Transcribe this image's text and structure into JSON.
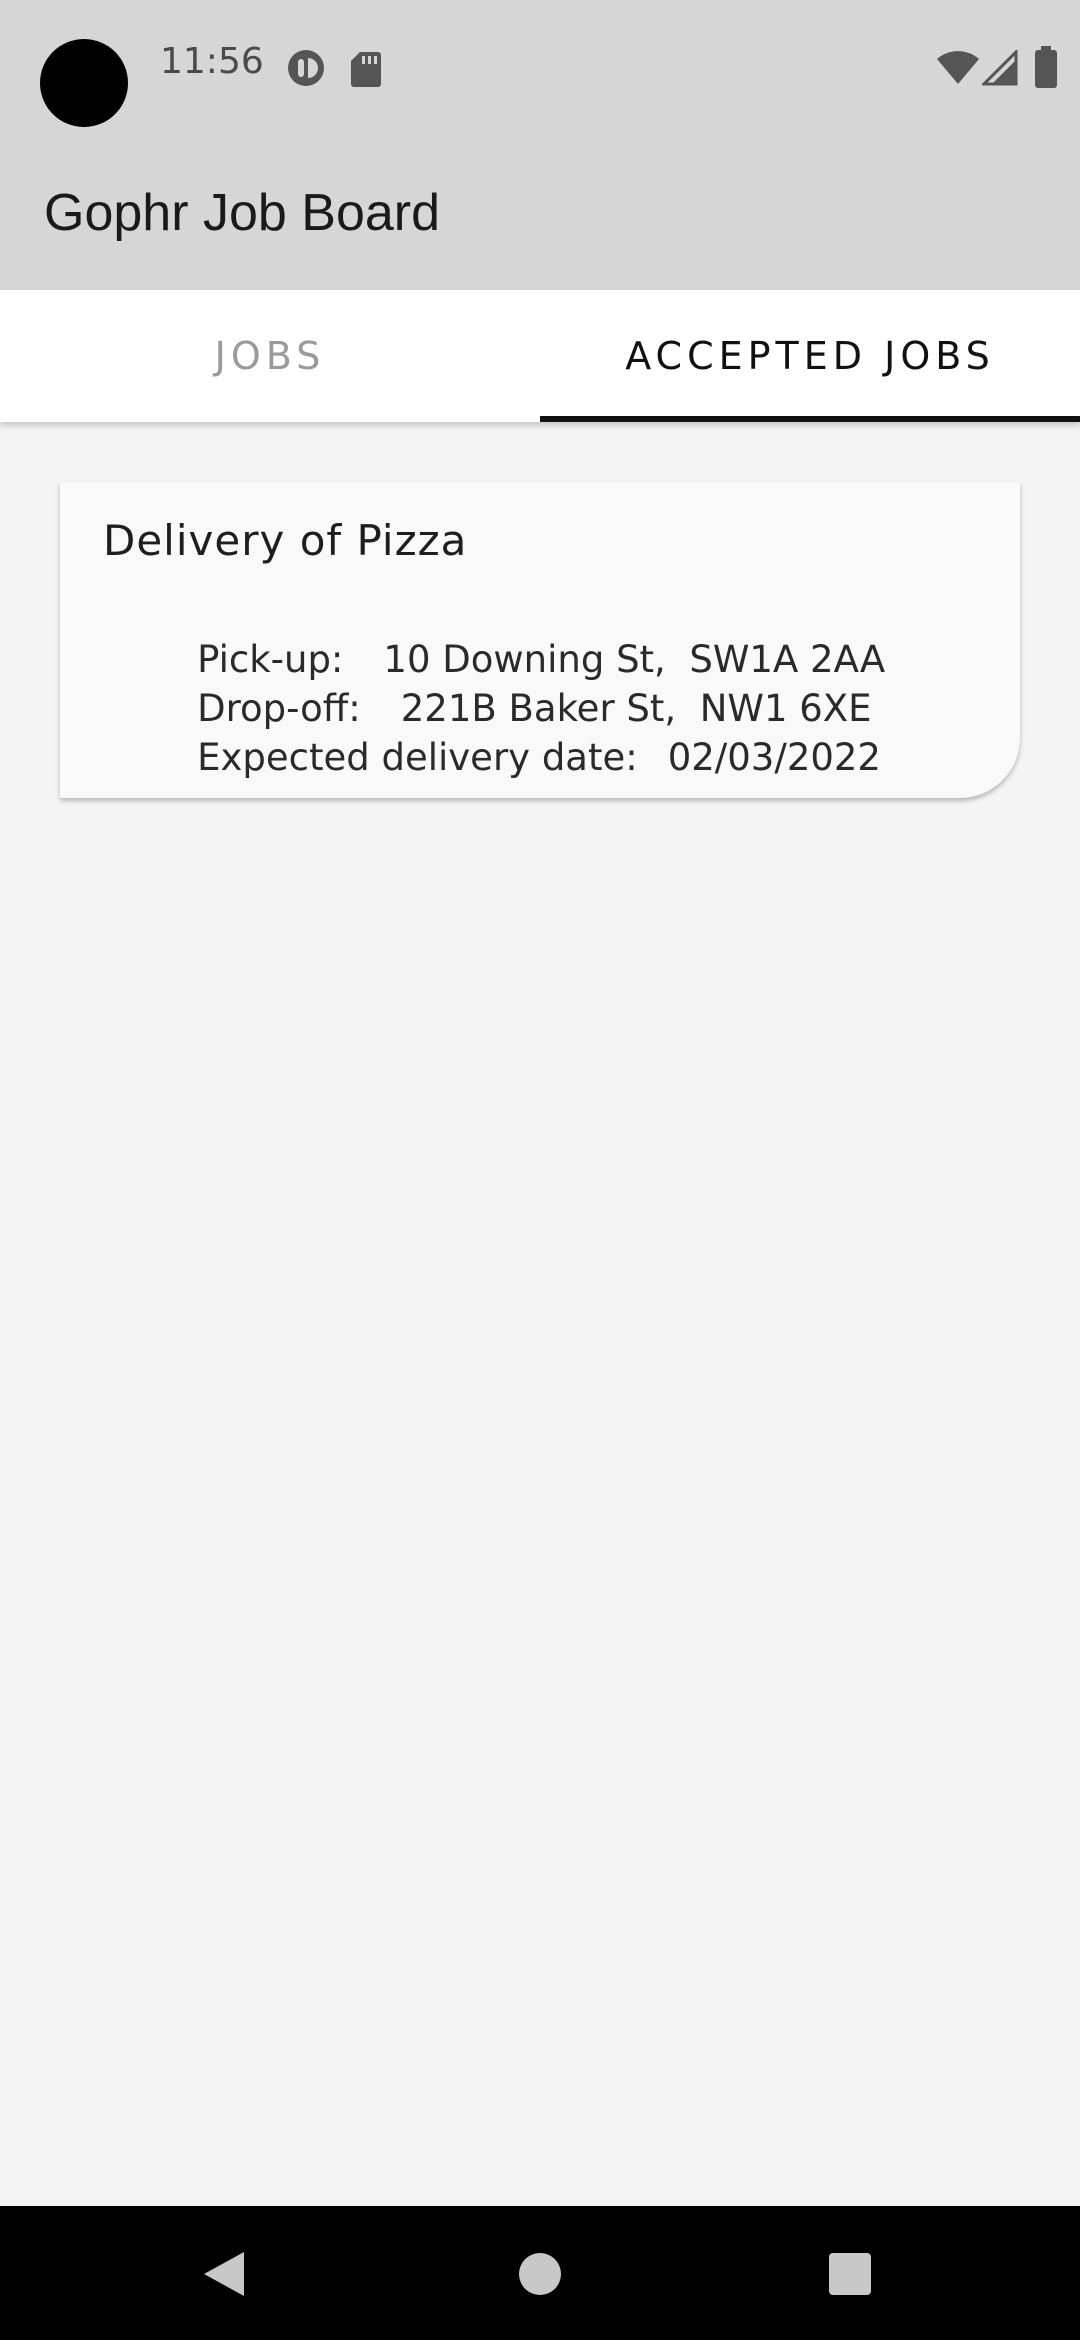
{
  "status_bar": {
    "time": "11:56",
    "icons": [
      "camera-cutout",
      "data-saver-icon",
      "sd-card-icon",
      "wifi-icon",
      "signal-icon",
      "battery-icon"
    ]
  },
  "app_bar": {
    "title": "Gophr Job Board"
  },
  "tabs": [
    {
      "label": "JOBS",
      "selected": false
    },
    {
      "label": "ACCEPTED JOBS",
      "selected": true
    }
  ],
  "accepted_jobs": [
    {
      "title": "Delivery of Pizza",
      "pickup_label": "Pick-up:",
      "pickup_value": "10 Downing St,  SW1A 2AA",
      "dropoff_label": "Drop-off:",
      "dropoff_value": "221B Baker St,  NW1 6XE",
      "date_label": "Expected delivery date:",
      "date_value": "02/03/2022"
    }
  ],
  "nav_bar": {
    "buttons": [
      "back-icon",
      "home-icon",
      "recents-icon"
    ]
  },
  "colors": {
    "app_bar_bg": "#d6d6d6",
    "tab_selected": "#111111",
    "tab_unselected": "#9a9a9a",
    "content_bg": "#f4f4f4",
    "card_bg": "#f9f9f9"
  }
}
